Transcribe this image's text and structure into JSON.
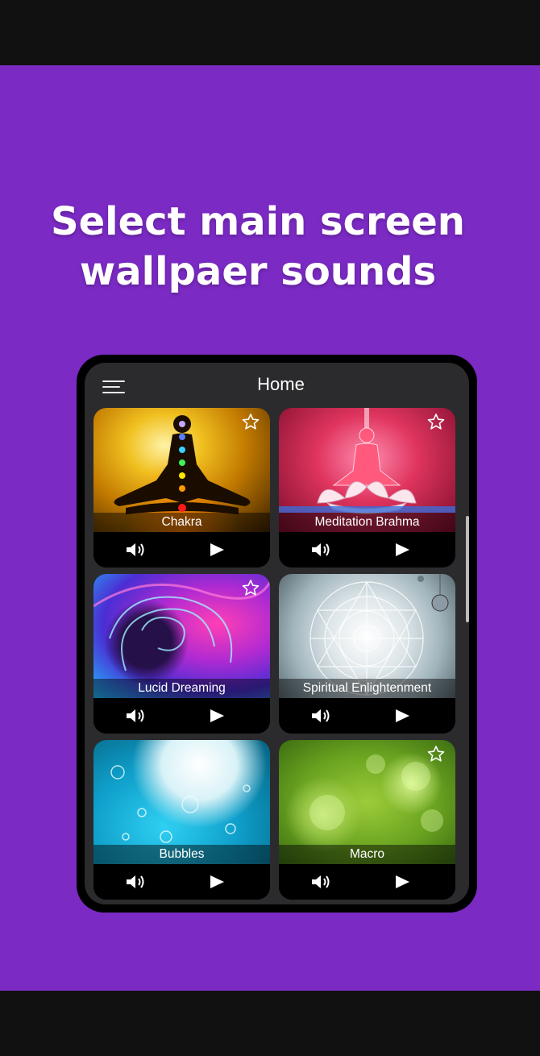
{
  "promo": {
    "headline_line1": "Select main screen",
    "headline_line2": "wallpaer sounds",
    "background_color": "#7b2ac4"
  },
  "app": {
    "title": "Home",
    "menu_icon": "hamburger-menu-icon"
  },
  "cards": [
    {
      "label": "Chakra",
      "favorite_icon": "star-outline-icon",
      "sound_icon": "speaker-icon",
      "play_icon": "play-icon"
    },
    {
      "label": "Meditation Brahma",
      "favorite_icon": "star-outline-icon",
      "sound_icon": "speaker-icon",
      "play_icon": "play-icon"
    },
    {
      "label": "Lucid Dreaming",
      "favorite_icon": "star-outline-icon",
      "sound_icon": "speaker-icon",
      "play_icon": "play-icon"
    },
    {
      "label": "Spiritual Enlightenment",
      "favorite_icon": "",
      "sound_icon": "speaker-icon",
      "play_icon": "play-icon"
    },
    {
      "label": "Bubbles",
      "favorite_icon": "",
      "sound_icon": "speaker-icon",
      "play_icon": "play-icon"
    },
    {
      "label": "Macro",
      "favorite_icon": "star-outline-icon",
      "sound_icon": "speaker-icon",
      "play_icon": "play-icon"
    }
  ]
}
